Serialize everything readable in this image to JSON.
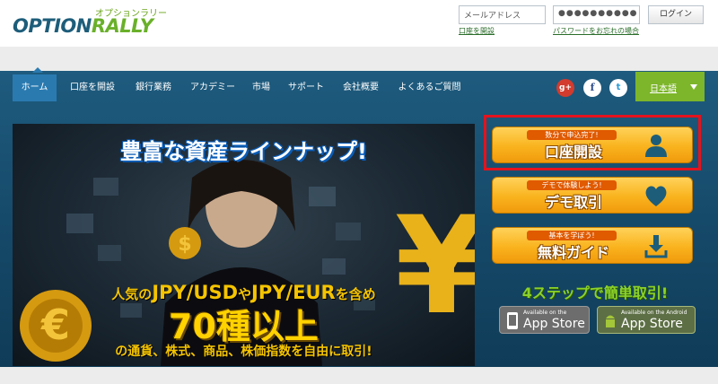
{
  "header": {
    "logo_small": "オプションラリー",
    "logo_main_part1": "OPTION",
    "logo_main_part2": "RALLY",
    "email_placeholder": "メールアドレス",
    "password_value": "●●●●●●●●●●",
    "login_label": "ログイン",
    "open_account_link": "口座を開設",
    "forgot_password_link": "パスワードをお忘れの場合"
  },
  "nav": {
    "items": [
      "ホーム",
      "口座を開設",
      "銀行業務",
      "アカデミー",
      "市場",
      "サポート",
      "会社概要",
      "よくあるご質問"
    ],
    "active_index": 0
  },
  "social": {
    "gplus": "g+",
    "facebook": "f",
    "twitter": "t"
  },
  "language": {
    "label": "日本語"
  },
  "banner": {
    "title": "豊富な資産ラインナップ!",
    "line1_a": "人気の",
    "line1_b": "JPY/USD",
    "line1_c": "や",
    "line1_d": "JPY/EUR",
    "line1_e": "を含め",
    "big": "70種以上",
    "line3": "の通貨、株式、商品、株価指数を自由に取引!"
  },
  "cta": {
    "open": {
      "small": "数分で申込完了!",
      "main": "口座開設",
      "icon": "person-icon"
    },
    "demo": {
      "small": "デモで体験しよう!",
      "main": "デモ取引",
      "icon": "heart-icon"
    },
    "guide": {
      "small": "基本を学ぼう!",
      "main": "無料ガイド",
      "icon": "download-icon"
    }
  },
  "steps": {
    "text": "4ステップで簡単取引!"
  },
  "stores": {
    "apple": {
      "small": "Available on the",
      "big": "App Store"
    },
    "android": {
      "small": "Available on the Android",
      "big": "App Store"
    }
  },
  "colors": {
    "nav_band": "#1e5b7e",
    "language_green": "#7db62a",
    "cta_orange": "#f9b31d",
    "highlight_red": "#e4131d",
    "steps_green": "#8bd12a"
  }
}
